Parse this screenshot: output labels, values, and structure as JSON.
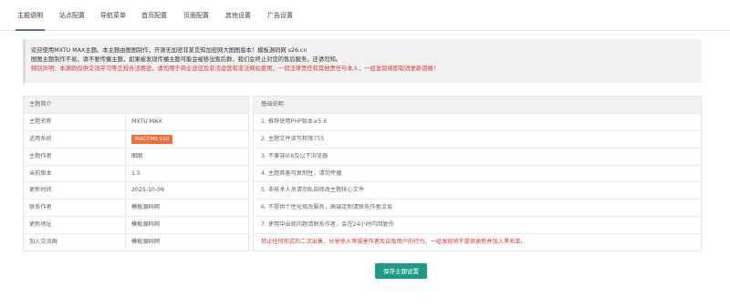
{
  "tabs": [
    {
      "label": "主题说明"
    },
    {
      "label": "站点配置"
    },
    {
      "label": "导航菜单"
    },
    {
      "label": "首页配置"
    },
    {
      "label": "页面配置"
    },
    {
      "label": "其他设置"
    },
    {
      "label": "广告设置"
    }
  ],
  "notice": {
    "line1": "欢迎使用MXTU MAX主题。本主题由图图制作，开源无加密非某觅知加密网大图图版本！模板源码网 s26.cn",
    "line2": "图图主题制作不易，请不要传播主题，如果被发现传播主题可能会被移出售后群，我们会终止对您的售后服务，还请勿知。",
    "line3": "特别声明：本源码仅供交流学习等正规合法用途，请勿用于商业途径及非法运营和非法网站使用，一切法律责任和其他责任与本人，一经发现将即取消更新资格！",
    "colors": {
      "warn": "#e0332b"
    }
  },
  "info": {
    "header": "主题简介",
    "rows": [
      {
        "key": "主题名称",
        "value": "MXTU MAX"
      },
      {
        "key": "适用系统",
        "value": "MACCMS V10",
        "badge": true
      },
      {
        "key": "主题作者",
        "value": "图图"
      },
      {
        "key": "当前版本",
        "value": "1.5"
      },
      {
        "key": "更新时间",
        "value": "2025-10-09"
      },
      {
        "key": "联系作者",
        "value": "模板源码网"
      },
      {
        "key": "更新地址",
        "value": "模板源码网"
      },
      {
        "key": "加入交流群",
        "value": "模板源码网"
      }
    ]
  },
  "notes": {
    "header": "基础说明",
    "items": [
      {
        "text": "1. 推荐使用PHP版本≥5.6"
      },
      {
        "text": "2. 主题文件读写权限755"
      },
      {
        "text": "3. 不兼容IE8及以下浏览器"
      },
      {
        "text": "4. 主题具备可复制性，请勿传播"
      },
      {
        "text": "5. 非技术人员请勿私自修改主题核心文件"
      },
      {
        "text": "6. 不提供个性化修改服务，高端定制请联系作者洽谈"
      },
      {
        "text": "7. 使用中出现问题请联系作者，会在24小时内回复你"
      },
      {
        "text": "禁止任何形式的二次出售、分享他人等侵害作者及正版用户的行为，一经发现将不提供更新并加入黑名单。",
        "warn": true
      }
    ]
  },
  "save_button": {
    "label": "保存主题设置",
    "color": "#1e9b88"
  },
  "badge_color": "#ef6c3b"
}
